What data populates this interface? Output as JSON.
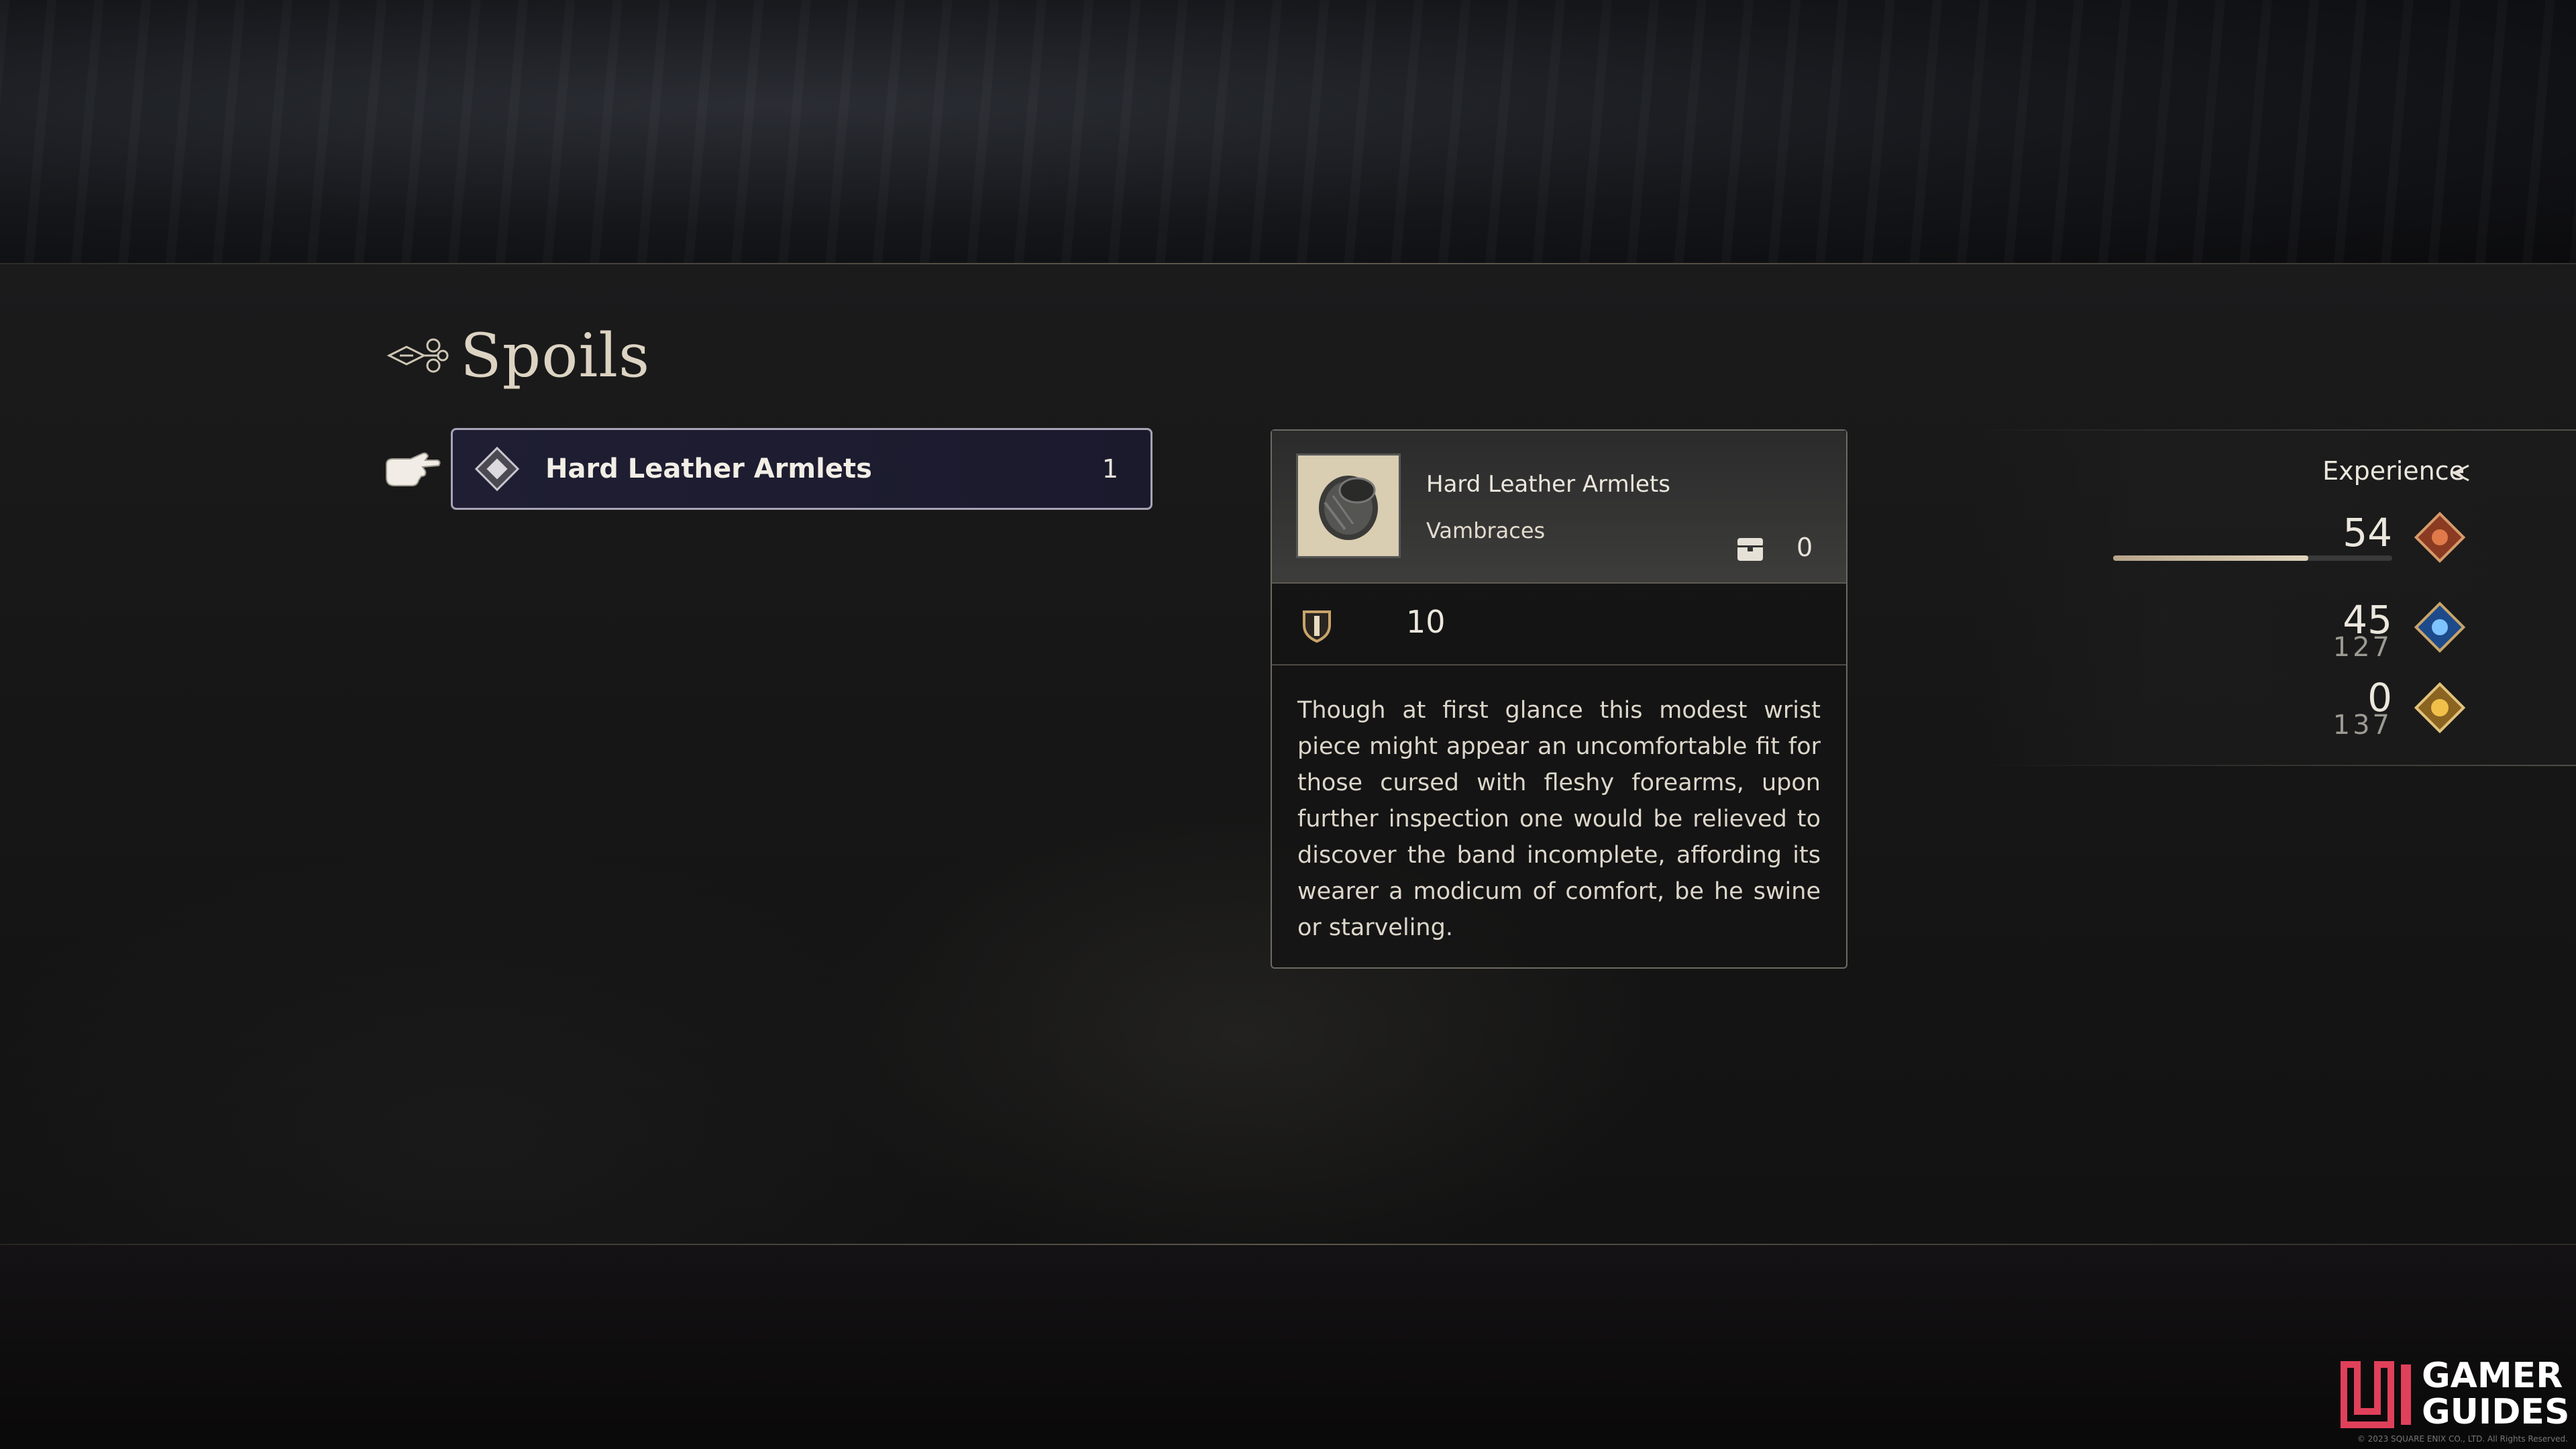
{
  "header": {
    "title": "Spoils"
  },
  "spoils_list": {
    "items": [
      {
        "label": "Hard Leather Armlets",
        "quantity": "1"
      }
    ]
  },
  "detail": {
    "name": "Hard Leather Armlets",
    "type": "Vambraces",
    "owned_count": "0",
    "defense_value": "10",
    "description": "Though at first glance this modest wrist piece might appear an uncomfortable fit for those cursed with fleshy forearms, upon further inspection one would be relieved to discover the band incomplete, affording its wearer a modicum of comfort, be he swine or starveling."
  },
  "experience": {
    "label": "Experience",
    "rows": [
      {
        "value": "54",
        "sub": "",
        "gem": "red-gem-icon",
        "bar_fraction": 0.7
      },
      {
        "value": "45",
        "sub": "127",
        "gem": "blue-gem-icon"
      },
      {
        "value": "0",
        "sub": "137",
        "gem": "gold-gem-icon"
      }
    ]
  },
  "watermark": {
    "line1": "GAMER",
    "line2": "GUIDES",
    "copyright": "© 2023 SQUARE ENIX CO., LTD. All Rights Reserved."
  },
  "colors": {
    "accent_gold": "#c9a46a",
    "row_selected_bg": "#1f1e33",
    "exp_bar": "#d8ccb4"
  }
}
